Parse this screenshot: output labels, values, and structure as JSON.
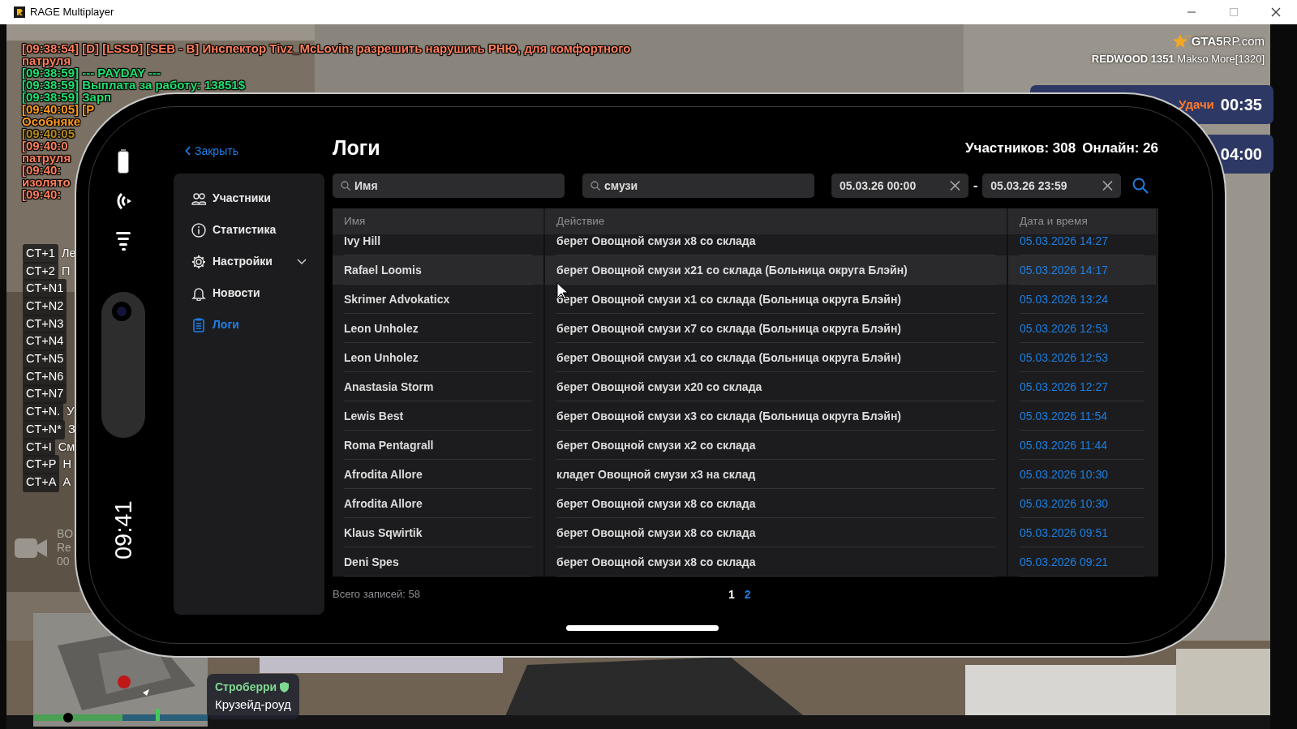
{
  "window": {
    "title": "RAGE Multiplayer"
  },
  "chat": [
    {
      "text": "[09:38:54] [D] [LSSD] [SEB - B] Инспектор Tivz_McLovin: разрешить нарушить РНЮ, для комфортного",
      "color": "#ff7f5c"
    },
    {
      "text": "патруля",
      "color": "#ff7f5c"
    },
    {
      "text": "[09:38:59] --- PAYDAY ---",
      "color": "#20e070"
    },
    {
      "text": "[09:38:59] Выплата за работу: 13851$",
      "color": "#20e070"
    },
    {
      "text": "[09:38:59] Зарп",
      "color": "#20e070"
    },
    {
      "text": "[09:40:05] [P",
      "color": "#ff9a24"
    },
    {
      "text": "Особняке",
      "color": "#ff9a24"
    },
    {
      "text": "[09:40:05",
      "color": "#b88a1c"
    },
    {
      "text": "[09:40:0",
      "color": "#ff7f5c"
    },
    {
      "text": "патруля",
      "color": "#ff7f5c"
    },
    {
      "text": "[09:40:",
      "color": "#ff7f5c"
    },
    {
      "text": "изолято",
      "color": "#ff7f5c"
    },
    {
      "text": "[09:40:",
      "color": "#ff7f5c"
    }
  ],
  "hotkeys": [
    {
      "key": "CT+1",
      "label": "Ле"
    },
    {
      "key": "CT+2",
      "label": "П"
    },
    {
      "key": "CT+N1"
    },
    {
      "key": "CT+N2"
    },
    {
      "key": "CT+N3"
    },
    {
      "key": "CT+N4"
    },
    {
      "key": "CT+N5"
    },
    {
      "key": "CT+N6"
    },
    {
      "key": "CT+N7"
    },
    {
      "key": "CT+N.",
      "label": "У"
    },
    {
      "key": "CT+N*",
      "label": "З"
    },
    {
      "key": "CT+I",
      "label": "См"
    },
    {
      "key": "CT+P",
      "label": "Н"
    },
    {
      "key": "CT+A",
      "label": "А"
    }
  ],
  "server": {
    "logo": "**GTA5**RP.com",
    "info": "**REDWOOD 1351** Makso More[1320]"
  },
  "timers": [
    {
      "label": "Удачи",
      "time": "00:35"
    },
    {
      "time": "04:00"
    }
  ],
  "recording": {
    "lines": [
      "BO",
      "Re",
      "00"
    ]
  },
  "location": {
    "district": "Строберри",
    "street": "Крузейд-роуд"
  },
  "phone": {
    "clock": "09:41",
    "close": "Закрыть",
    "title": "Логи",
    "stats": [
      "Участников: 308",
      "Онлайн: 26"
    ],
    "menu": [
      {
        "label": "Участники",
        "kind": "people",
        "selected": false
      },
      {
        "label": "Статистика",
        "kind": "info",
        "selected": false
      },
      {
        "label": "Настройки",
        "kind": "gear",
        "selected": false,
        "expanded": false
      },
      {
        "label": "Новости",
        "kind": "bell",
        "selected": false
      },
      {
        "label": "Логи",
        "kind": "clipboard",
        "selected": true
      }
    ],
    "filters": {
      "name": {
        "placeholder": "Имя"
      },
      "action": {
        "value": "смузи"
      },
      "date_from": {
        "value": "05.03.26 00:00"
      },
      "separator": "-",
      "date_to": {
        "value": "05.03.26 23:59"
      }
    },
    "table": {
      "columns": [
        "Имя",
        "Действие",
        "Дата и время"
      ],
      "rows": [
        {
          "name": "Ivy Hill",
          "action": "берет Овощной смузи x8 со склада",
          "date": "05.03.2026 14:27",
          "highlighted": false
        },
        {
          "name": "Rafael Loomis",
          "action": "берет Овощной смузи x21 со склада (Больница округа Блэйн)",
          "date": "05.03.2026 14:17",
          "highlighted": true
        },
        {
          "name": "Skrimer Advokaticx",
          "action": "берет Овощной смузи x1 со склада (Больница округа Блэйн)",
          "date": "05.03.2026 13:24",
          "highlighted": false
        },
        {
          "name": "Leon Unholez",
          "action": "берет Овощной смузи x7 со склада (Больница округа Блэйн)",
          "date": "05.03.2026 12:53",
          "highlighted": false
        },
        {
          "name": "Leon Unholez",
          "action": "берет Овощной смузи x1 со склада (Больница округа Блэйн)",
          "date": "05.03.2026 12:53",
          "highlighted": false
        },
        {
          "name": "Anastasia Storm",
          "action": "берет Овощной смузи x20 со склада",
          "date": "05.03.2026 12:27",
          "highlighted": false
        },
        {
          "name": "Lewis Best",
          "action": "берет Овощной смузи x3 со склада (Больница округа Блэйн)",
          "date": "05.03.2026 11:54",
          "highlighted": false
        },
        {
          "name": "Roma Pentagrall",
          "action": "берет Овощной смузи x2 со склада",
          "date": "05.03.2026 11:44",
          "highlighted": false
        },
        {
          "name": "Afrodita Allore",
          "action": "кладет Овощной смузи x3 на склад",
          "date": "05.03.2026 10:30",
          "highlighted": false
        },
        {
          "name": "Afrodita Allore",
          "action": "берет Овощной смузи x8 со склада",
          "date": "05.03.2026 10:30",
          "highlighted": false
        },
        {
          "name": "Klaus Sqwirtik",
          "action": "берет Овощной смузи x8 со склада",
          "date": "05.03.2026 09:51",
          "highlighted": false
        },
        {
          "name": "Deni Spes",
          "action": "берет Овощной смузи x8 со склада",
          "date": "05.03.2026 09:21",
          "highlighted": false
        }
      ]
    },
    "total": "Всего записей: 58",
    "pages": [
      {
        "label": "1",
        "selected": true
      },
      {
        "label": "2",
        "selected": false
      }
    ]
  }
}
